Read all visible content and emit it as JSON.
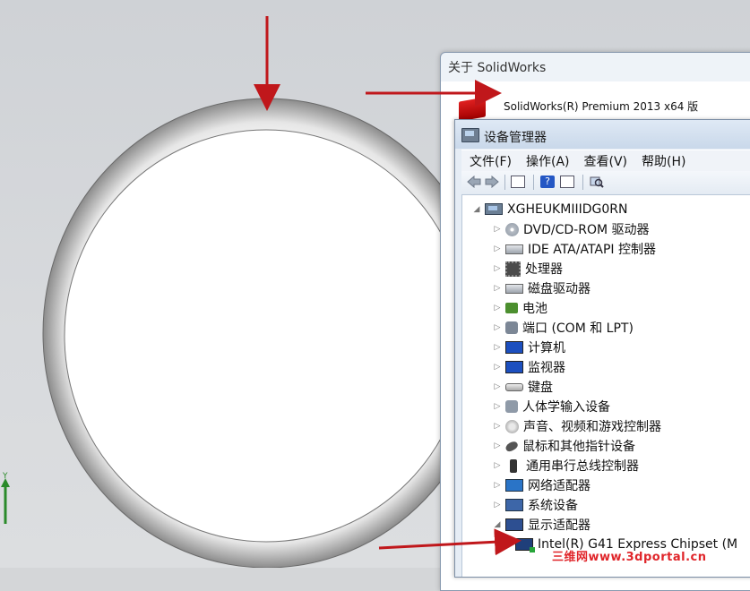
{
  "about_dialog": {
    "title": "关于 SolidWorks",
    "product_line": "SolidWorks(R) Premium 2013 x64 版"
  },
  "device_manager": {
    "title": "设备管理器",
    "menu": [
      "文件(F)",
      "操作(A)",
      "查看(V)",
      "帮助(H)"
    ],
    "toolbar_icons": [
      "back-arrow-icon",
      "forward-arrow-icon",
      "properties-icon",
      "help-icon",
      "view-icon",
      "scan-hardware-icon"
    ],
    "tree": {
      "root": "XGHEUKMIIIDG0RN",
      "categories": [
        {
          "label": "DVD/CD-ROM 驱动器",
          "icon": "disc-drive-icon",
          "expander": "▷"
        },
        {
          "label": "IDE ATA/ATAPI 控制器",
          "icon": "ide-controller-icon",
          "expander": "▷"
        },
        {
          "label": "处理器",
          "icon": "processor-icon",
          "expander": "▷"
        },
        {
          "label": "磁盘驱动器",
          "icon": "disk-drive-icon",
          "expander": "▷"
        },
        {
          "label": "电池",
          "icon": "battery-icon",
          "expander": "▷"
        },
        {
          "label": "端口 (COM 和 LPT)",
          "icon": "port-icon",
          "expander": "▷"
        },
        {
          "label": "计算机",
          "icon": "computer-icon",
          "expander": "▷"
        },
        {
          "label": "监视器",
          "icon": "monitor-icon",
          "expander": "▷"
        },
        {
          "label": "键盘",
          "icon": "keyboard-icon",
          "expander": "▷"
        },
        {
          "label": "人体学输入设备",
          "icon": "human-interface-icon",
          "expander": "▷"
        },
        {
          "label": "声音、视频和游戏控制器",
          "icon": "sound-icon",
          "expander": "▷"
        },
        {
          "label": "鼠标和其他指针设备",
          "icon": "mouse-icon",
          "expander": "▷"
        },
        {
          "label": "通用串行总线控制器",
          "icon": "usb-icon",
          "expander": "▷"
        },
        {
          "label": "网络适配器",
          "icon": "network-adapter-icon",
          "expander": "▷"
        },
        {
          "label": "系统设备",
          "icon": "system-device-icon",
          "expander": "▷"
        },
        {
          "label": "显示适配器",
          "icon": "display-adapter-icon",
          "expander": "◢"
        }
      ],
      "child": "Intel(R) G41 Express Chipset (M"
    }
  },
  "watermark": "三维网www.3dportal.cn",
  "axis_label": "Y",
  "colors": {
    "arrow": "#c0171b",
    "watermark": "#e0252a",
    "viewport": "#d4d6d8"
  }
}
